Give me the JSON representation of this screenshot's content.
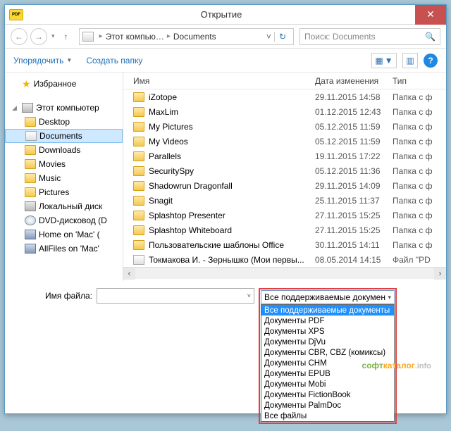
{
  "title": "Открытие",
  "app_icon_label": "PDF",
  "nav": {
    "back": "←",
    "fwd": "→",
    "hist": "▾",
    "up": "↑"
  },
  "breadcrumb": {
    "root": "Этот компью…",
    "current": "Documents",
    "sep": "▸",
    "drop": "˅",
    "refresh": "↻"
  },
  "search": {
    "placeholder": "Поиск: Documents",
    "icon": "🔍"
  },
  "toolbar": {
    "organize": "Упорядочить",
    "new_folder": "Создать папку",
    "view_icon": "▦",
    "preview_icon": "▥",
    "help": "?"
  },
  "sidebar": {
    "favorites": "Избранное",
    "this_pc": "Этот компьютер",
    "items": [
      {
        "label": "Desktop",
        "ico": "ico-folder"
      },
      {
        "label": "Documents",
        "ico": "ico-doc",
        "selected": true
      },
      {
        "label": "Downloads",
        "ico": "ico-folder"
      },
      {
        "label": "Movies",
        "ico": "ico-folder"
      },
      {
        "label": "Music",
        "ico": "ico-folder"
      },
      {
        "label": "Pictures",
        "ico": "ico-folder"
      },
      {
        "label": "Локальный диск",
        "ico": "ico-drive"
      },
      {
        "label": "DVD-дисковод (D",
        "ico": "ico-disk"
      },
      {
        "label": "Home on 'Mac' (",
        "ico": "ico-net"
      },
      {
        "label": "AllFiles on 'Mac'",
        "ico": "ico-net"
      }
    ]
  },
  "columns": {
    "name": "Имя",
    "date": "Дата изменения",
    "type": "Тип"
  },
  "files": [
    {
      "name": "iZotope",
      "date": "29.11.2015 14:58",
      "type": "Папка с ф",
      "ico": "ico-folder"
    },
    {
      "name": "MaxLim",
      "date": "01.12.2015 12:43",
      "type": "Папка с ф",
      "ico": "ico-folder"
    },
    {
      "name": "My Pictures",
      "date": "05.12.2015 11:59",
      "type": "Папка с ф",
      "ico": "ico-folder"
    },
    {
      "name": "My Videos",
      "date": "05.12.2015 11:59",
      "type": "Папка с ф",
      "ico": "ico-folder"
    },
    {
      "name": "Parallels",
      "date": "19.11.2015 17:22",
      "type": "Папка с ф",
      "ico": "ico-folder"
    },
    {
      "name": "SecuritySpy",
      "date": "05.12.2015 11:36",
      "type": "Папка с ф",
      "ico": "ico-folder"
    },
    {
      "name": "Shadowrun Dragonfall",
      "date": "29.11.2015 14:09",
      "type": "Папка с ф",
      "ico": "ico-folder"
    },
    {
      "name": "Snagit",
      "date": "25.11.2015 11:37",
      "type": "Папка с ф",
      "ico": "ico-folder"
    },
    {
      "name": "Splashtop Presenter",
      "date": "27.11.2015 15:25",
      "type": "Папка с ф",
      "ico": "ico-folder"
    },
    {
      "name": "Splashtop Whiteboard",
      "date": "27.11.2015 15:25",
      "type": "Папка с ф",
      "ico": "ico-folder"
    },
    {
      "name": "Пользовательские шаблоны Office",
      "date": "30.11.2015 14:11",
      "type": "Папка с ф",
      "ico": "ico-folder"
    },
    {
      "name": "Токмакова И. - Зернышко (Мои первы...",
      "date": "08.05.2014 14:15",
      "type": "Файл \"PD",
      "ico": "ico-doc"
    }
  ],
  "footer": {
    "filename_label": "Имя файла:",
    "drop": "˅"
  },
  "filter": {
    "selected": "Все поддерживаемые докумен",
    "options": [
      "Все поддерживаемые документы",
      "Документы PDF",
      "Документы XPS",
      "Документы DjVu",
      "Документы CBR, CBZ (комиксы)",
      "Документы CHM",
      "Документы EPUB",
      "Документы Mobi",
      "Документы FictionBook",
      "Документы PalmDoc",
      "Все файлы"
    ]
  },
  "watermark": {
    "p1": "софт",
    "p2": "каталог",
    "p3": ".info"
  }
}
